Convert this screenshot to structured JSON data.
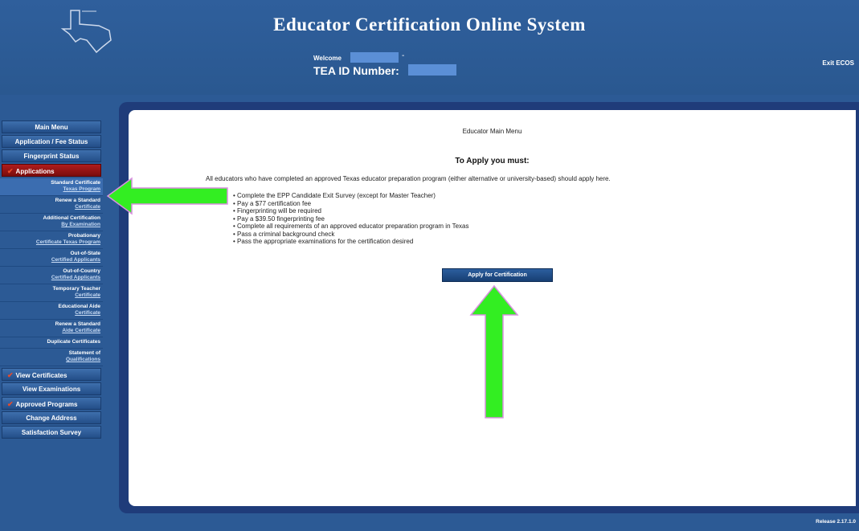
{
  "header": {
    "title": "Educator Certification Online System",
    "welcome_label": "Welcome",
    "tea_id_label": "TEA ID Number:",
    "exit_label": "Exit ECOS"
  },
  "sidebar": {
    "main_items": [
      {
        "label": "Main Menu"
      },
      {
        "label": "Application / Fee Status"
      },
      {
        "label": "Fingerprint Status"
      }
    ],
    "applications_label": "Applications",
    "application_sub_items": [
      {
        "line1": "Standard Certificate",
        "line2": "Texas Program"
      },
      {
        "line1": "Renew a Standard",
        "line2": "Certificate"
      },
      {
        "line1": "Additional Certification",
        "line2": "By Examination"
      },
      {
        "line1": "Probationary",
        "line2": "Certificate Texas Program"
      },
      {
        "line1": "Out-of-State",
        "line2": "Certified Applicants"
      },
      {
        "line1": "Out-of-Country",
        "line2": "Certified Applicants"
      },
      {
        "line1": "Temporary Teacher",
        "line2": "Certificate"
      },
      {
        "line1": "Educational Aide",
        "line2": "Certificate"
      },
      {
        "line1": "Renew a Standard",
        "line2": "Aide Certificate"
      },
      {
        "line1": "Duplicate Certificates",
        "line2": ""
      },
      {
        "line1": "Statement of",
        "line2": "Qualifications"
      }
    ],
    "lower_items": [
      {
        "label": "View Certificates",
        "check": true
      },
      {
        "label": "View Examinations",
        "check": false
      },
      {
        "label": "Approved Programs",
        "check": true
      },
      {
        "label": "Change Address",
        "check": false
      },
      {
        "label": "Satisfaction Survey",
        "check": false
      }
    ]
  },
  "main": {
    "menu_title": "Educator Main Menu",
    "apply_heading": "To Apply you must:",
    "intro": "All educators who have completed an approved Texas educator preparation program (either alternative or university-based) should apply here.",
    "requirements": [
      "Complete the EPP Candidate Exit Survey (except for Master Teacher)",
      "Pay a $77 certification fee",
      "Fingerprinting will be required",
      "Pay a $39.50 fingerprinting fee",
      "Complete all requirements of an approved educator preparation program in Texas",
      "Pass a criminal background check",
      "Pass the appropriate examinations for the certification desired"
    ],
    "apply_button": "Apply for Certification"
  },
  "footer": {
    "release": "Release 2.17.1.0"
  },
  "colors": {
    "header_bg": "#2f5f9c",
    "panel_frame": "#1f3c7a",
    "active_nav": "#b01c1c",
    "annotation_arrow": "#33ee22"
  },
  "icons": [
    "texas-logo-icon",
    "checkmark-icon",
    "green-arrow-icon"
  ]
}
